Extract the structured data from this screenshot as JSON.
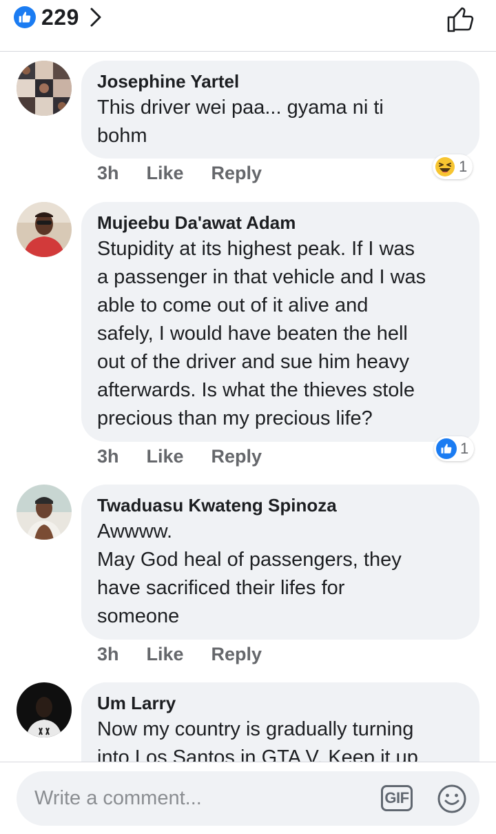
{
  "header": {
    "like_count": "229",
    "like_badge_icon": "thumbs-up-icon",
    "like_color": "#1b7cf2"
  },
  "comments": [
    {
      "author": "Josephine Yartel",
      "lines": [
        "This driver wei paa... gyama ni ti",
        "bohm"
      ],
      "time": "3h",
      "like_label": "Like",
      "reply_label": "Reply",
      "reaction": {
        "icon": "haha-emoji-icon",
        "count": "1"
      }
    },
    {
      "author": "Mujeebu Da'awat Adam",
      "lines": [
        "Stupidity at its highest peak. If I was",
        "a passenger in that vehicle and I was",
        "able to come out of it alive and",
        "safely, I would have beaten the hell",
        "out of the driver and sue him heavy",
        "afterwards. Is what the thieves stole",
        "precious than my precious life?"
      ],
      "time": "3h",
      "like_label": "Like",
      "reply_label": "Reply",
      "reaction": {
        "icon": "like-reaction-icon",
        "count": "1"
      }
    },
    {
      "author": "Twaduasu Kwateng Spinoza",
      "lines": [
        "Awwww.",
        "May God heal of passengers, they",
        "have sacrificed their lifes for",
        "someone"
      ],
      "time": "3h",
      "like_label": "Like",
      "reply_label": "Reply"
    },
    {
      "author": "Um Larry",
      "lines": [
        "Now my country is gradually turning",
        "into Los Santos in GTA V. Keep it up"
      ]
    }
  ],
  "composer": {
    "placeholder": "Write a comment...",
    "gif_label": "GIF",
    "emoji_icon": "smiley-icon"
  }
}
